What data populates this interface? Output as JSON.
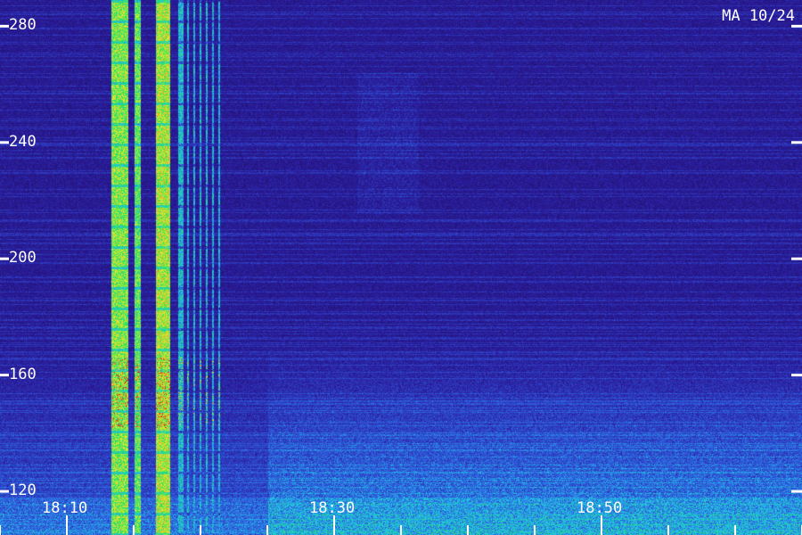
{
  "title": "MA 10/24",
  "chart_data": {
    "type": "heatmap",
    "title": "MA 10/24",
    "y_tick_labels": [
      "280",
      "240",
      "200",
      "160",
      "120"
    ],
    "y_ticks": [
      280,
      240,
      200,
      160,
      120
    ],
    "ylim": [
      105,
      289
    ],
    "x_tick_labels": [
      "18:10",
      "18:30",
      "18:50"
    ],
    "x_ticks_minutes": [
      1090,
      1110,
      1130
    ],
    "xlim_minutes": [
      1085,
      1145
    ],
    "x_minor_tick_step_minutes": 5,
    "colormap": [
      "#1b0c4a",
      "#2a1a9a",
      "#2f5de0",
      "#22c8e8",
      "#22e060",
      "#e0f030",
      "#f08020",
      "#e02010"
    ],
    "grid": false
  }
}
